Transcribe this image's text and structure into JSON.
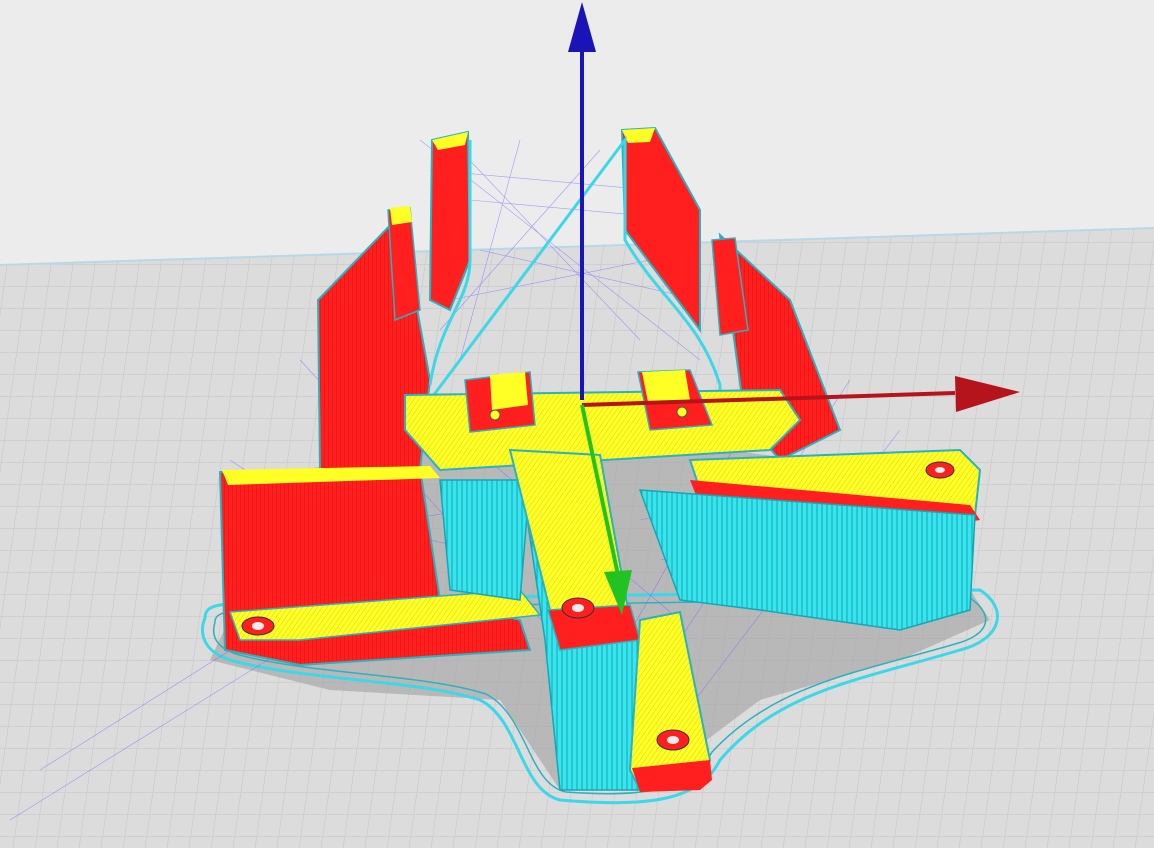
{
  "app": {
    "view": "3d-slice-preview"
  },
  "colors": {
    "background": "#ececec",
    "build_plate": "#dcdcdc",
    "grid_line": "#c8c8c8",
    "outer_wall": "#ff1a1a",
    "top_bottom": "#ffff22",
    "support": "#33e6f0",
    "skirt": "#3ad8e8",
    "travel": "#6a5cff",
    "axis_x": "#b5141c",
    "axis_y": "#22c222",
    "axis_z": "#1a14b8"
  },
  "icons": {
    "axis_x": "x-axis-arrow-icon",
    "axis_y": "y-axis-arrow-icon",
    "axis_z": "z-axis-arrow-icon"
  }
}
